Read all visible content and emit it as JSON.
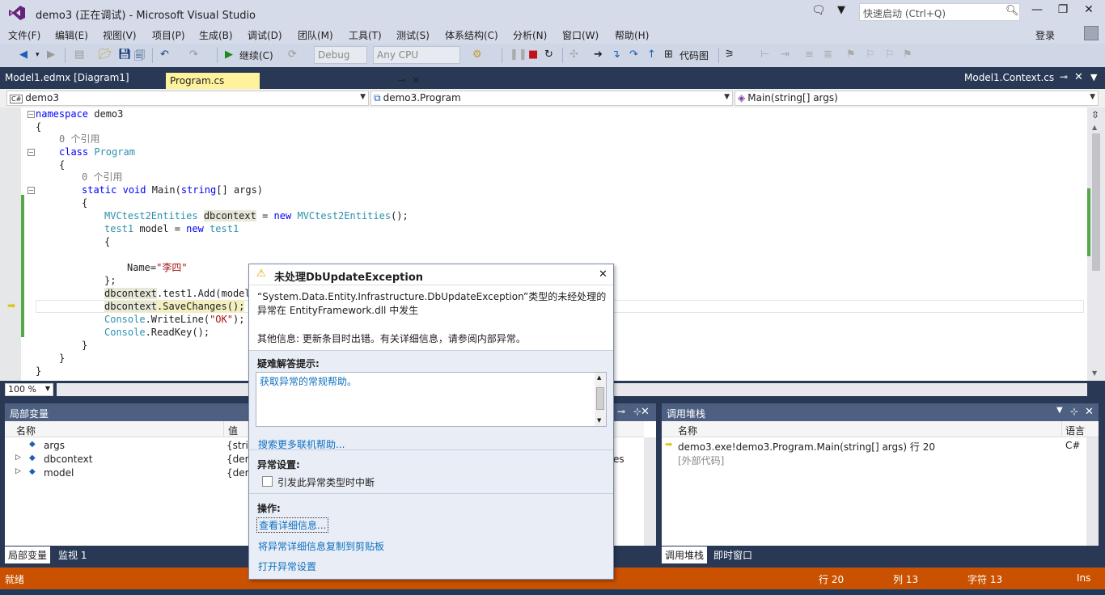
{
  "window": {
    "title": "demo3 (正在调试) - Microsoft Visual Studio",
    "quick_launch_placeholder": "快速启动 (Ctrl+Q)",
    "login": "登录"
  },
  "menu": [
    "文件(F)",
    "编辑(E)",
    "视图(V)",
    "项目(P)",
    "生成(B)",
    "调试(D)",
    "团队(M)",
    "工具(T)",
    "测试(S)",
    "体系结构(C)",
    "分析(N)",
    "窗口(W)",
    "帮助(H)"
  ],
  "toolbar": {
    "continue_label": "继续(C)",
    "config": "Debug",
    "platform": "Any CPU",
    "codemap_label": "代码图"
  },
  "tabs": {
    "model_tab": "Model1.edmx [Diagram1]",
    "program_tab": "Program.cs",
    "context_tab": "Model1.Context.cs"
  },
  "navbar": {
    "project": "demo3",
    "class": "demo3.Program",
    "member": "Main(string[] args)"
  },
  "editor": {
    "zoom": "100 %",
    "lines": [
      {
        "t": "namespace demo3"
      },
      {
        "t": "{"
      },
      {
        "t": "    0 个引用"
      },
      {
        "t": "    class Program"
      },
      {
        "t": "    {"
      },
      {
        "t": "        0 个引用"
      },
      {
        "t": "        static void Main(string[] args)"
      },
      {
        "t": "        {"
      },
      {
        "t": "            MVCtest2Entities dbcontext = new MVCtest2Entities();"
      },
      {
        "t": "            test1 model = new test1"
      },
      {
        "t": "            {"
      },
      {
        "t": ""
      },
      {
        "t": "                Name=\"李四\""
      },
      {
        "t": "            };"
      },
      {
        "t": "            dbcontext.test1.Add(model);"
      },
      {
        "t": "            dbcontext.SaveChanges();"
      },
      {
        "t": "            Console.WriteLine(\"OK\");"
      },
      {
        "t": "            Console.ReadKey();"
      },
      {
        "t": "        }"
      },
      {
        "t": "    }"
      },
      {
        "t": "}"
      }
    ]
  },
  "locals": {
    "title": "局部变量",
    "col_name": "名称",
    "col_value": "值",
    "rows": [
      {
        "name": "args",
        "value": "{strin"
      },
      {
        "name": "dbcontext",
        "value": "{dem"
      },
      {
        "name": "model",
        "value": "{dem"
      }
    ],
    "value_tail": "es",
    "tab_locals": "局部变量",
    "tab_watch": "监视 1"
  },
  "callstack": {
    "title": "调用堆栈",
    "col_name": "名称",
    "col_lang": "语言",
    "rows": [
      {
        "name": "demo3.exe!demo3.Program.Main(string[] args) 行 20",
        "lang": "C#"
      },
      {
        "name": "[外部代码]",
        "lang": ""
      }
    ],
    "tab_callstack": "调用堆栈",
    "tab_immediate": "即时窗口"
  },
  "status": {
    "state": "就绪",
    "line": "行 20",
    "col": "列 13",
    "char": "字符 13",
    "mode": "Ins"
  },
  "exception": {
    "title": "未处理DbUpdateException",
    "message": "“System.Data.Entity.Infrastructure.DbUpdateException”类型的未经处理的异常在 EntityFramework.dll 中发生",
    "other_info": "其他信息: 更新条目时出错。有关详细信息，请参阅内部异常。",
    "tips_header": "疑难解答提示:",
    "tip_link": "获取异常的常规帮助。",
    "search_link": "搜索更多联机帮助...",
    "settings_header": "异常设置:",
    "break_checkbox": "引发此异常类型时中断",
    "actions_header": "操作:",
    "action_details": "查看详细信息...",
    "action_copy": "将异常详细信息复制到剪贴板",
    "action_settings": "打开异常设置"
  },
  "colors": {
    "accent": "#293955",
    "status_bar": "#ca5100",
    "tab_active": "#fff29d",
    "link": "#0e70c0"
  }
}
